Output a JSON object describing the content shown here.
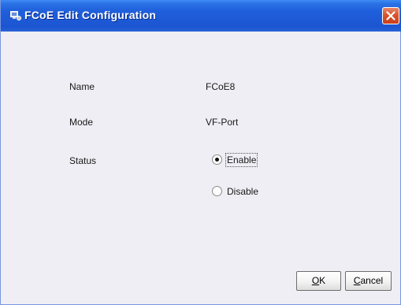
{
  "window": {
    "title": "FCoE Edit Configuration",
    "app_icon": "server-settings-icon",
    "close_icon": "close-icon"
  },
  "form": {
    "name_label": "Name",
    "name_value": "FCoE8",
    "mode_label": "Mode",
    "mode_value": "VF-Port",
    "status_label": "Status",
    "status_options": [
      {
        "label": "Enable",
        "selected": true
      },
      {
        "label": "Disable",
        "selected": false
      }
    ]
  },
  "buttons": {
    "ok": {
      "mnemonic": "O",
      "rest": "K"
    },
    "cancel": {
      "mnemonic": "C",
      "rest": "ancel"
    }
  },
  "colors": {
    "titlebar": "#1f5fdc",
    "close_button": "#d9532b",
    "content_background": "#eeeef4"
  }
}
